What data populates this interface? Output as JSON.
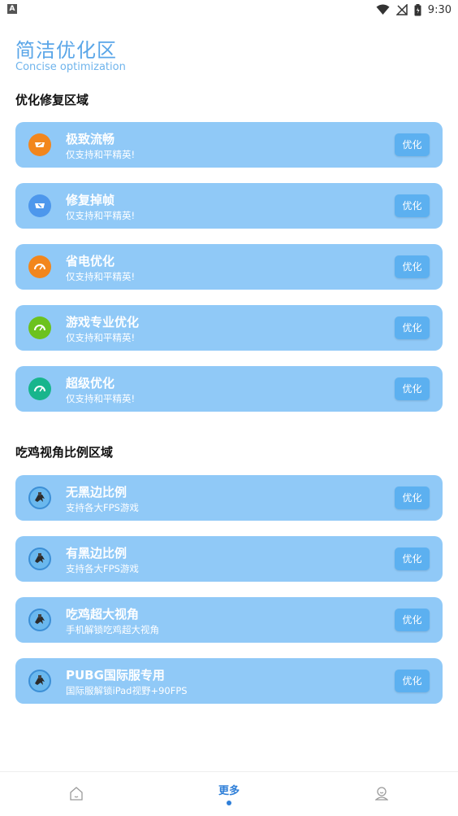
{
  "status_bar": {
    "time": "9:30",
    "app_badge": "A"
  },
  "header": {
    "title": "简洁优化区",
    "subtitle": "Concise optimization"
  },
  "sections": [
    {
      "title": "优化修复区域",
      "items": [
        {
          "label": "极致流畅",
          "desc": "仅支持和平精英!",
          "button": "优化",
          "icon": "speedometer-icon",
          "color": "#f2861d"
        },
        {
          "label": "修复掉帧",
          "desc": "仅支持和平精英!",
          "button": "优化",
          "icon": "speedometer-icon",
          "color": "#4d97ec"
        },
        {
          "label": "省电优化",
          "desc": "仅支持和平精英!",
          "button": "优化",
          "icon": "gauge-icon",
          "color": "#f2861d"
        },
        {
          "label": "游戏专业优化",
          "desc": "仅支持和平精英!",
          "button": "优化",
          "icon": "gauge-icon",
          "color": "#6cc21e"
        },
        {
          "label": "超级优化",
          "desc": "仅支持和平精英!",
          "button": "优化",
          "icon": "gauge-icon",
          "color": "#18b58c"
        }
      ]
    },
    {
      "title": "吃鸡视角比例区域",
      "items": [
        {
          "label": "无黑边比例",
          "desc": "支持各大FPS游戏",
          "button": "优化",
          "icon": "game-character-icon"
        },
        {
          "label": "有黑边比例",
          "desc": "支持各大FPS游戏",
          "button": "优化",
          "icon": "game-character-icon"
        },
        {
          "label": "吃鸡超大视角",
          "desc": "手机解锁吃鸡超大视角",
          "button": "优化",
          "icon": "game-character-icon"
        },
        {
          "label": "PUBG国际服专用",
          "desc": "国际服解锁iPad视野+90FPS",
          "button": "优化",
          "icon": "game-character-icon"
        }
      ]
    }
  ],
  "bottom_nav": {
    "home_icon": "home-icon",
    "more_label": "更多",
    "profile_icon": "profile-icon",
    "active_color": "#2f7fd8"
  }
}
